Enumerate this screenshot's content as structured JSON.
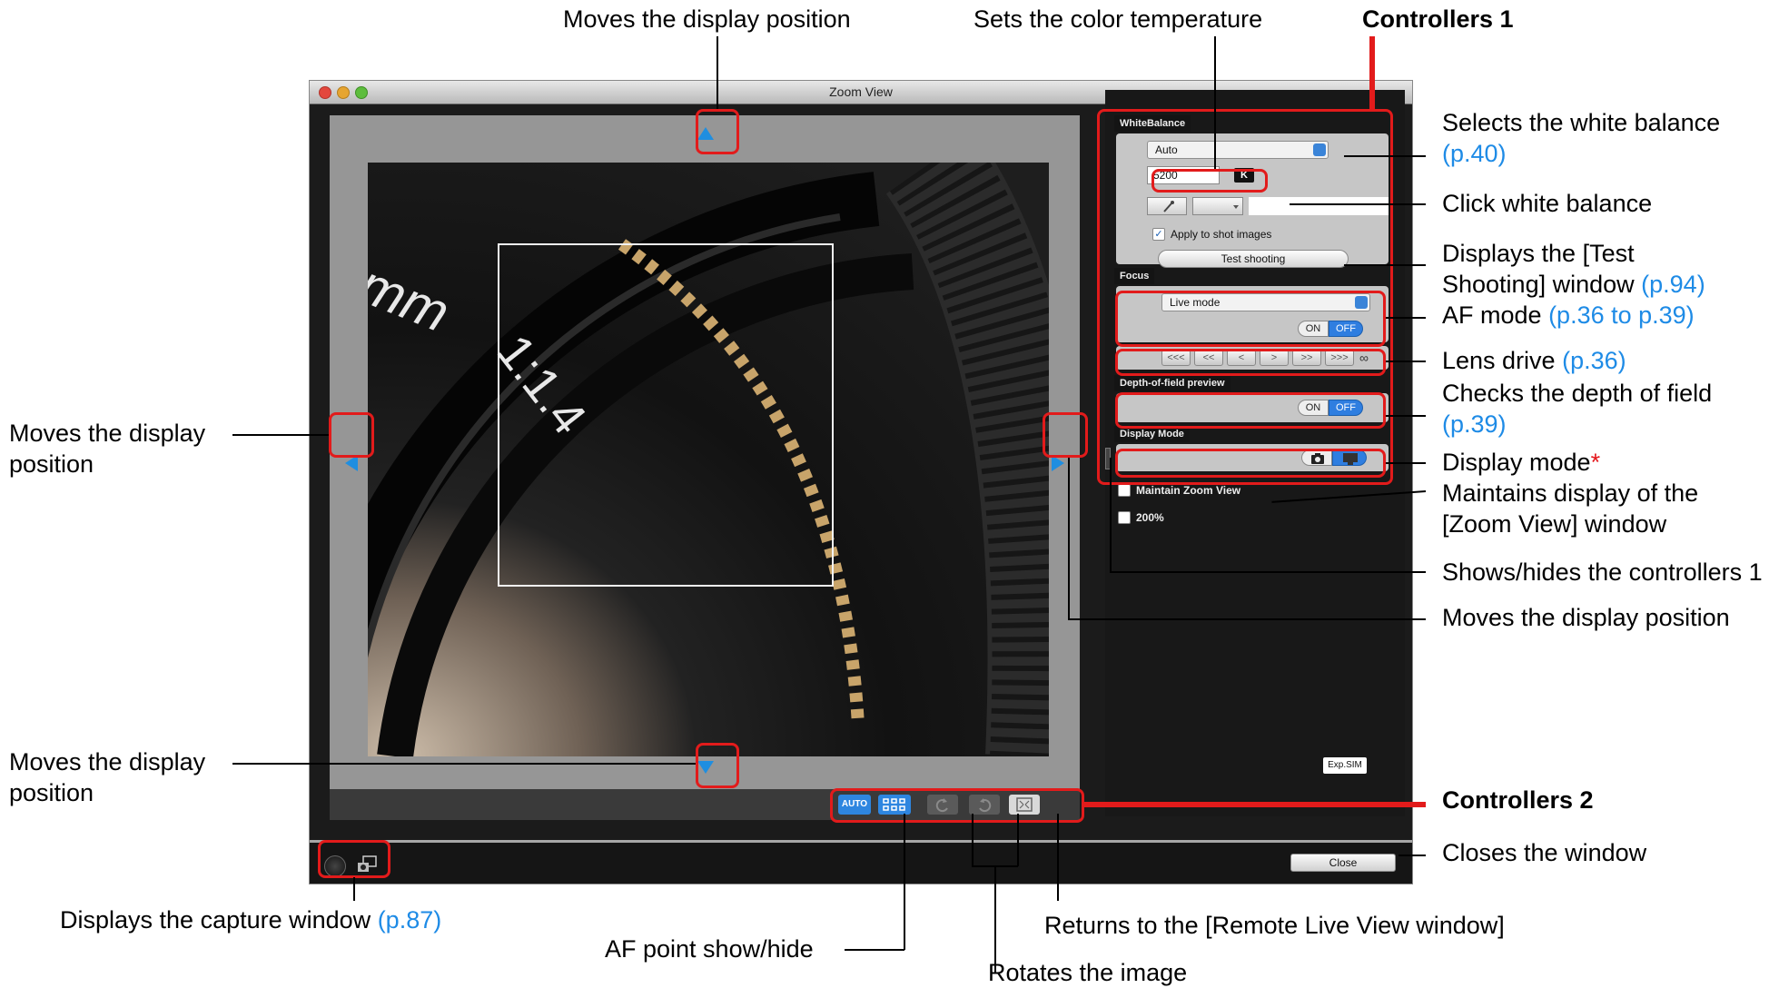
{
  "window": {
    "title": "Zoom View"
  },
  "white_balance": {
    "header": "WhiteBalance",
    "mode": "Auto",
    "kelvin_value": "5200",
    "kelvin_unit": "K",
    "apply_label": "Apply to shot images",
    "apply_checked": true,
    "test_button": "Test shooting"
  },
  "focus": {
    "header": "Focus",
    "mode": "Live mode",
    "on_label": "ON",
    "off_label": "OFF",
    "lens_buttons": [
      "<<<",
      "<<",
      "<",
      ">",
      ">>",
      ">>>"
    ],
    "infinity": "∞"
  },
  "dof": {
    "header": "Depth-of-field preview",
    "on_label": "ON",
    "off_label": "OFF"
  },
  "display_mode": {
    "header": "Display Mode"
  },
  "options": {
    "maintain_label": "Maintain Zoom View",
    "zoom200_label": "200%",
    "expsim": "Exp.SIM"
  },
  "toolbar": {
    "auto_label": "AUTO"
  },
  "footer": {
    "close_label": "Close"
  },
  "photo": {
    "lens_text_1": "mm",
    "lens_text_2": "1:1.4"
  },
  "annotations": {
    "top_move": "Moves the display position",
    "color_temp": "Sets the color temperature",
    "controllers1": "Controllers 1",
    "select_wb": "Selects the white balance",
    "select_wb_ref": "(p.40)",
    "click_wb": "Click white balance",
    "test_line1": "Displays the [Test",
    "test_line2": "Shooting] window",
    "test_ref": "(p.94)",
    "af_mode": "AF mode",
    "af_ref": "(p.36 to p.39)",
    "lens_drive": "Lens drive",
    "lens_ref": "(p.36)",
    "dof_line1": "Checks the depth of field",
    "dof_ref": "(p.39)",
    "display_mode": "Display mode",
    "display_star": "*",
    "maintain_line1": "Maintains display of the",
    "maintain_line2": "[Zoom View] window",
    "showhide": "Shows/hides the controllers 1",
    "right_move": "Moves the display position",
    "left_move_1": "Moves the display",
    "left_move_2": "position",
    "bottom_move_1": "Moves the display",
    "bottom_move_2": "position",
    "controllers2": "Controllers 2",
    "closes": "Closes the window",
    "capture": "Displays the capture window",
    "capture_ref": "(p.87)",
    "af_point": "AF point show/hide",
    "returns": "Returns to the [Remote Live View window]",
    "rotates": "Rotates the image"
  }
}
